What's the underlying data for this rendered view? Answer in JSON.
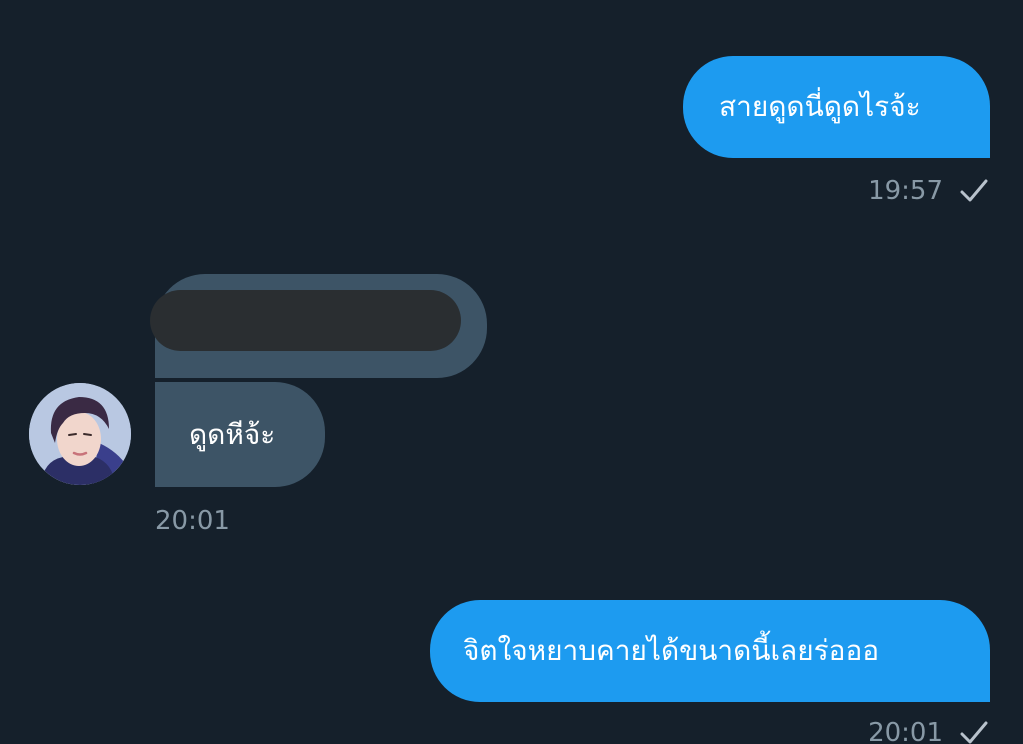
{
  "messages": [
    {
      "direction": "sent",
      "text": "สายดูดนี่ดูดไรจ้ะ",
      "time": "19:57",
      "status_icon": "check-icon"
    },
    {
      "direction": "received",
      "text": "",
      "redacted": true
    },
    {
      "direction": "received",
      "text": "ดูดหีจ้ะ",
      "time": "20:01",
      "avatar_icon": "avatar-photo"
    },
    {
      "direction": "sent",
      "text": "จิตใจหยาบคายได้ขนาดนี้เลยร่อออ",
      "time": "20:01",
      "status_icon": "check-icon"
    }
  ],
  "colors": {
    "background": "#15202b",
    "sent_bubble": "#1d9bf0",
    "received_bubble": "#3d5466",
    "timestamp": "#8899a6",
    "redaction": "#2a2e31"
  }
}
